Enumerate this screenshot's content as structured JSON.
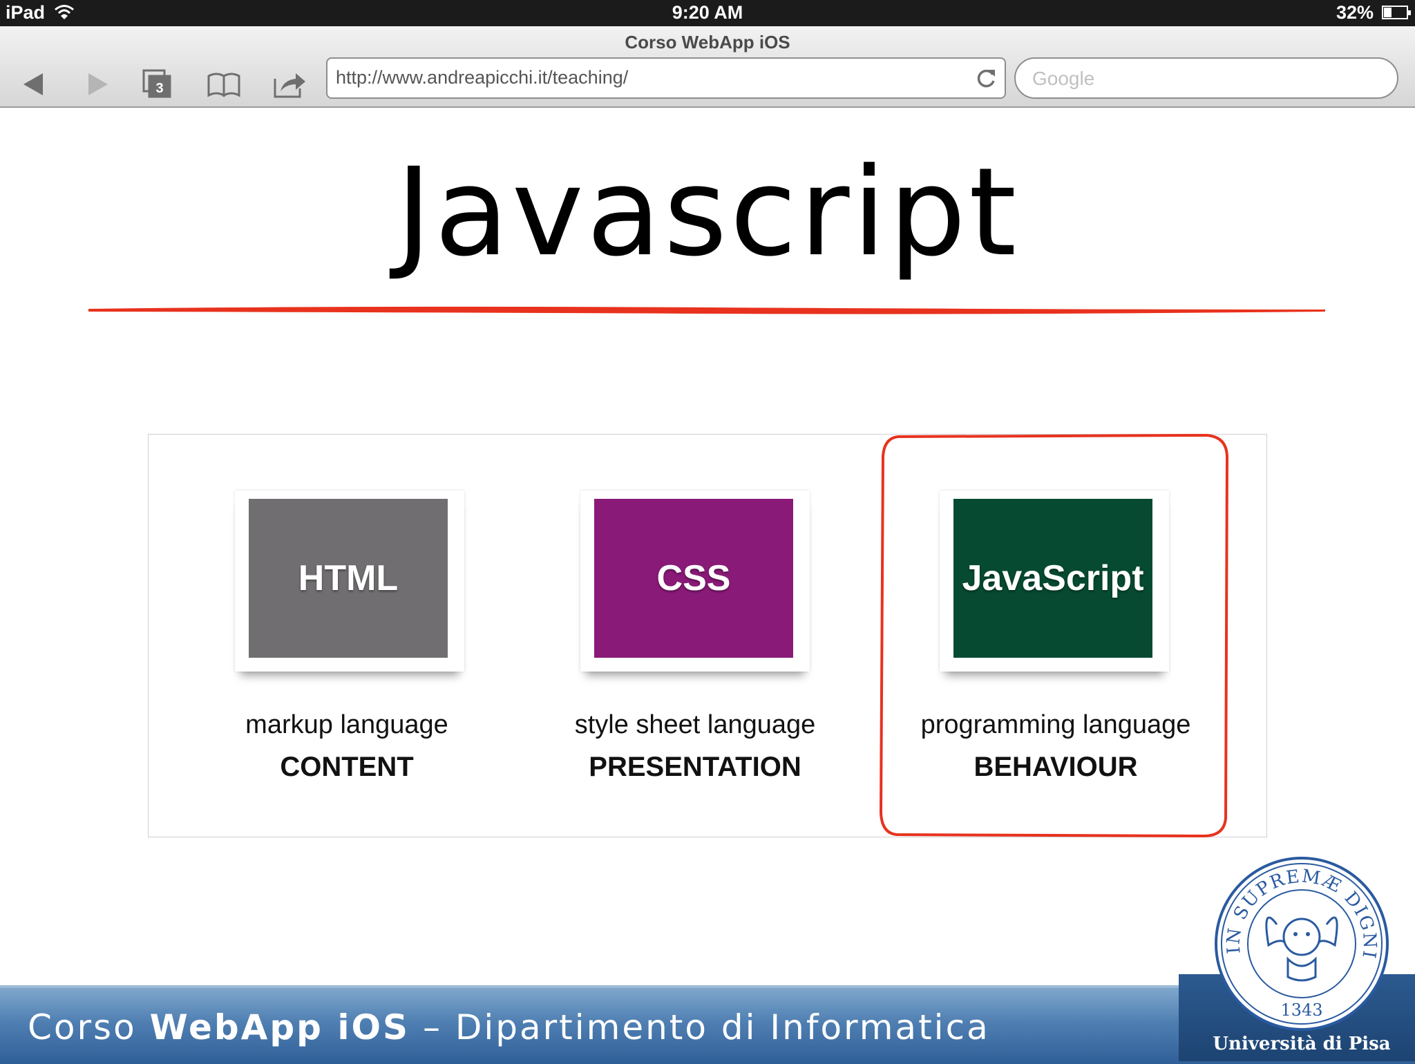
{
  "status_bar": {
    "device": "iPad",
    "time": "9:20 AM",
    "battery": "32%",
    "battery_level": 0.32
  },
  "browser": {
    "page_title": "Corso WebApp iOS",
    "tab_count": "3",
    "url": "http://www.andreapicchi.it/teaching/",
    "search_placeholder": "Google",
    "icons": [
      "back-arrow-icon",
      "forward-arrow-icon",
      "tabs-icon",
      "bookmarks-icon",
      "share-icon",
      "reload-icon",
      "wifi-icon",
      "battery-icon"
    ]
  },
  "slide": {
    "title": "Javascript",
    "accent_color": "#e8321e",
    "cards": [
      {
        "tile_text": "HTML",
        "tile_color": "#706e70",
        "description": "markup language",
        "label": "CONTENT"
      },
      {
        "tile_text": "CSS",
        "tile_color": "#8a1a78",
        "description": "style sheet language",
        "label": "PRESENTATION"
      },
      {
        "tile_text": "JavaScript",
        "tile_color": "#064a31",
        "description": "programming language",
        "label": "BEHAVIOUR"
      }
    ],
    "highlighted_card": "JavaScript"
  },
  "footer": {
    "course_prefix": "Corso",
    "course_name": "WebApp iOS",
    "department": "– Dipartimento di Informatica",
    "seal_motto": "IN SUPREMÆ DIGNITATIS",
    "seal_year": "1343",
    "university": "Università di Pisa"
  }
}
